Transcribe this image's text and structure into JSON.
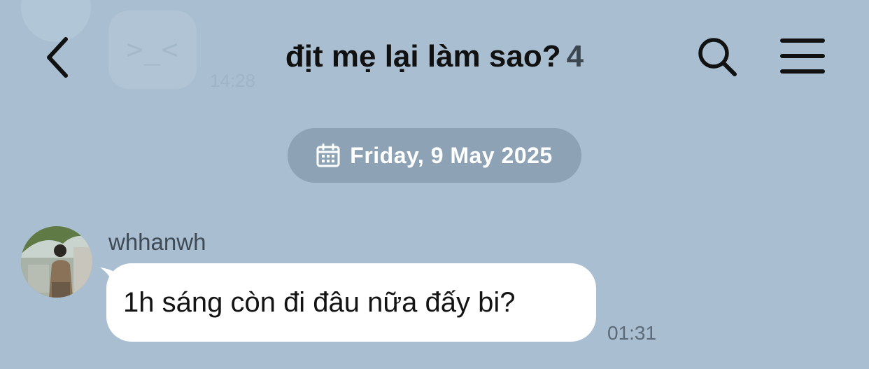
{
  "previous_message": {
    "emoticon": ">_<",
    "time": "14:28"
  },
  "header": {
    "title": "địt mẹ lại làm sao?",
    "member_count": "4",
    "icons": {
      "back": "back-arrow-icon",
      "search": "search-icon",
      "menu": "hamburger-menu-icon"
    }
  },
  "date_divider": {
    "label": "Friday, 9 May 2025",
    "icon": "calendar-icon"
  },
  "message": {
    "sender": "whhanwh",
    "text": "1h sáng còn đi đâu nữa đấy bi?",
    "time": "01:31"
  },
  "colors": {
    "background": "#a9bfd1",
    "date_pill": "#8da3b5",
    "bubble": "#ffffff",
    "title": "#111111"
  }
}
